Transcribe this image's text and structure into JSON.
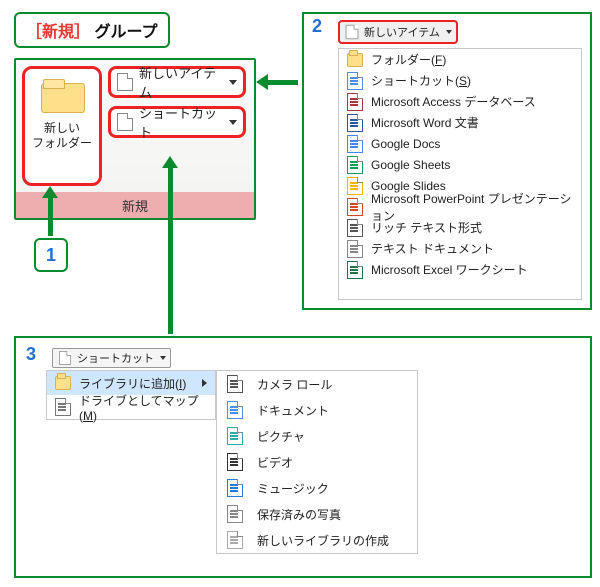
{
  "header": {
    "bracket_open": "［",
    "name": "新規",
    "bracket_close": "］",
    "suffix": "グループ"
  },
  "steps": {
    "one": "1",
    "two": "2",
    "three": "3"
  },
  "ribbon": {
    "new_folder_line1": "新しい",
    "new_folder_line2": "フォルダー",
    "new_item": "新しいアイテム",
    "shortcut": "ショートカット",
    "caption": "新規"
  },
  "panel2": {
    "header": "新しいアイテム",
    "items": [
      {
        "label_pre": "フォルダー(",
        "ul": "F",
        "label_post": ")",
        "icon": "folder"
      },
      {
        "label_pre": "ショートカット(",
        "ul": "S",
        "label_post": ")",
        "icon": "shortcut"
      },
      {
        "label": "Microsoft Access データベース",
        "icon": "access"
      },
      {
        "label": "Microsoft Word 文書",
        "icon": "word"
      },
      {
        "label": "Google Docs",
        "icon": "gdoc"
      },
      {
        "label": "Google Sheets",
        "icon": "gsheet"
      },
      {
        "label": "Google Slides",
        "icon": "gslide"
      },
      {
        "label": "Microsoft PowerPoint プレゼンテーション",
        "icon": "ppt"
      },
      {
        "label": "リッチ テキスト形式",
        "icon": "rtf"
      },
      {
        "label": "テキスト ドキュメント",
        "icon": "txt"
      },
      {
        "label": "Microsoft Excel ワークシート",
        "icon": "excel"
      }
    ]
  },
  "panel3": {
    "header": "ショートカット",
    "items": [
      {
        "label_pre": "ライブラリに追加(",
        "ul": "I",
        "label_post": ")",
        "icon": "lib",
        "highlight": true,
        "has_sub": true
      },
      {
        "label_pre": "ドライブとしてマップ(",
        "ul": "M",
        "label_post": ")",
        "icon": "drive"
      }
    ],
    "sub_items": [
      {
        "label": "カメラ ロール",
        "icon": "camera"
      },
      {
        "label": "ドキュメント",
        "icon": "doc"
      },
      {
        "label": "ピクチャ",
        "icon": "pic"
      },
      {
        "label": "ビデオ",
        "icon": "video"
      },
      {
        "label": "ミュージック",
        "icon": "music"
      },
      {
        "label": "保存済みの写真",
        "icon": "saved"
      },
      {
        "label": "新しいライブラリの作成",
        "icon": "newlib"
      }
    ]
  },
  "colors": {
    "accent": "#0b8a2e",
    "highlight": "#e22",
    "step": "#2570d4"
  }
}
